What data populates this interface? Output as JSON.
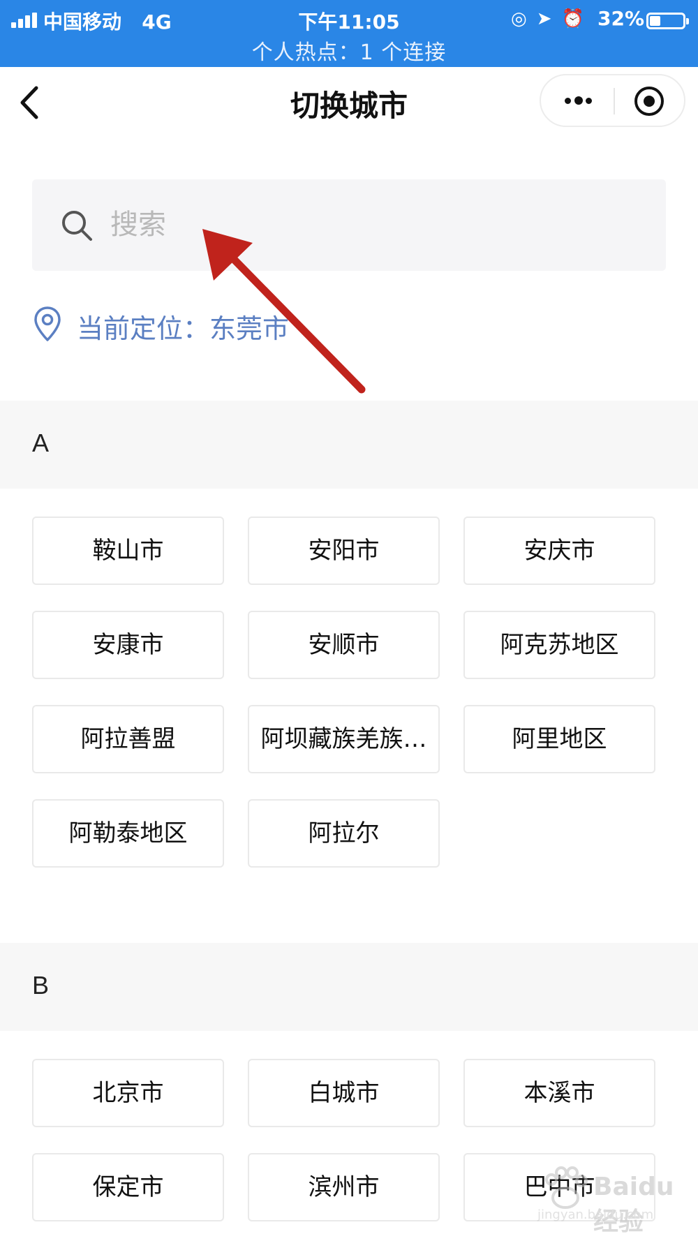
{
  "status_bar": {
    "carrier": "中国移动",
    "network": "4G",
    "time": "下午11:05",
    "battery_percent": "32%",
    "battery_level": 0.32,
    "hotspot": "个人热点：1 个连接"
  },
  "nav": {
    "title": "切换城市"
  },
  "search": {
    "placeholder": "搜索"
  },
  "location": {
    "label": "当前定位：",
    "city": "东莞市"
  },
  "sections": [
    {
      "letter": "A",
      "cities": [
        "鞍山市",
        "安阳市",
        "安庆市",
        "安康市",
        "安顺市",
        "阿克苏地区",
        "阿拉善盟",
        "阿坝藏族羌族…",
        "阿里地区",
        "阿勒泰地区",
        "阿拉尔"
      ]
    },
    {
      "letter": "B",
      "cities": [
        "北京市",
        "白城市",
        "本溪市",
        "保定市",
        "滨州市",
        "巴中市"
      ]
    }
  ],
  "annotation": {
    "arrow_color": "#c0231c"
  },
  "watermark": {
    "brand": "Baidu经验",
    "url": "jingyan.baidu.com"
  }
}
